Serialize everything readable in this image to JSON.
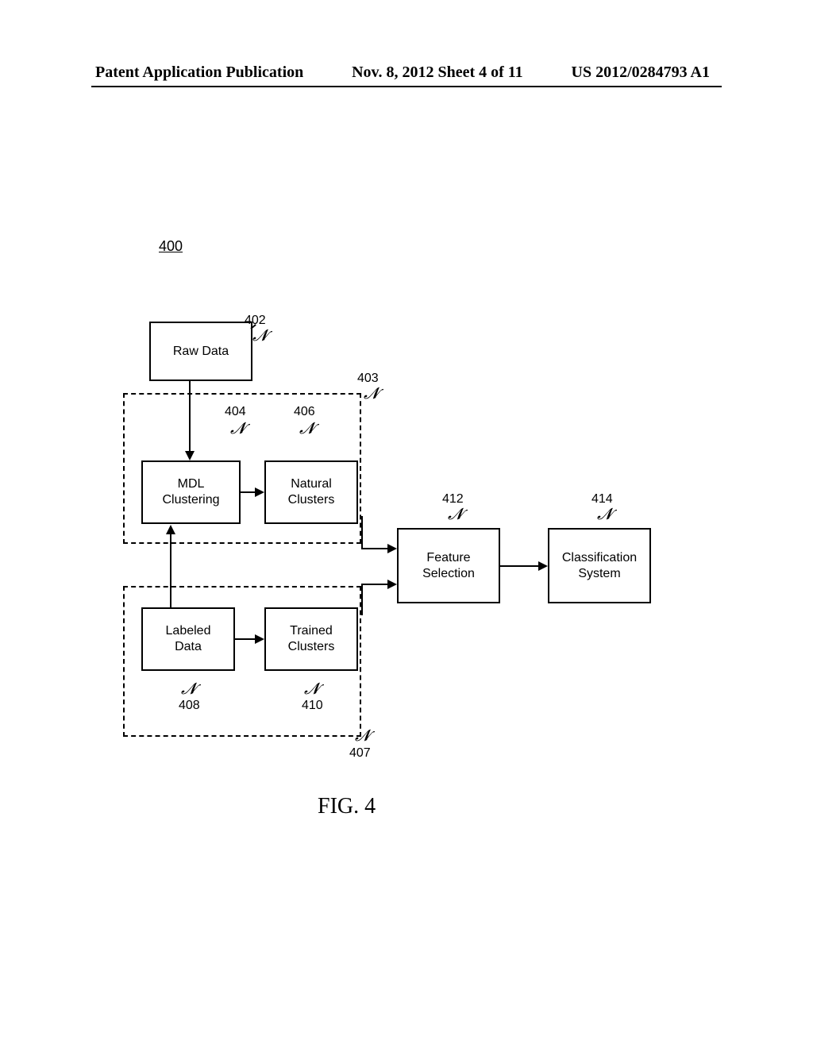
{
  "header": {
    "left": "Patent Application Publication",
    "center": "Nov. 8, 2012  Sheet 4 of 11",
    "right": "US 2012/0284793 A1"
  },
  "figure_number": "400",
  "figure_caption": "FIG. 4",
  "boxes": {
    "raw_data": {
      "label": "Raw Data",
      "ref": "402"
    },
    "mdl_clustering": {
      "label": "MDL\nClustering",
      "ref": "404"
    },
    "natural_clusters": {
      "label": "Natural\nClusters",
      "ref": "406"
    },
    "labeled_data": {
      "label": "Labeled\nData",
      "ref": "408"
    },
    "trained_clusters": {
      "label": "Trained\nClusters",
      "ref": "410"
    },
    "feature_selection": {
      "label": "Feature\nSelection",
      "ref": "412"
    },
    "classification_system": {
      "label": "Classification\nSystem",
      "ref": "414"
    }
  },
  "groups": {
    "top_dashed": {
      "ref": "403"
    },
    "bottom_dashed": {
      "ref": "407"
    }
  }
}
